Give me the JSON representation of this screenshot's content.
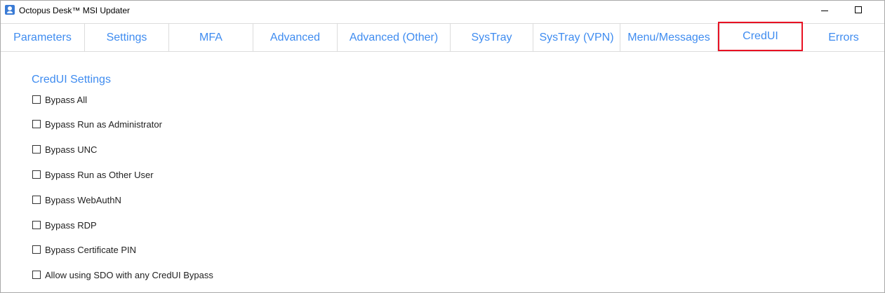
{
  "window": {
    "title": "Octopus Desk™ MSI Updater"
  },
  "tabs": [
    {
      "label": "Parameters"
    },
    {
      "label": "Settings"
    },
    {
      "label": "MFA"
    },
    {
      "label": "Advanced"
    },
    {
      "label": "Advanced (Other)"
    },
    {
      "label": "SysTray"
    },
    {
      "label": "SysTray (VPN)"
    },
    {
      "label": "Menu/Messages"
    },
    {
      "label": "CredUI"
    },
    {
      "label": "Errors"
    }
  ],
  "active_tab": "CredUI",
  "section": {
    "title": "CredUI Settings",
    "options": [
      {
        "label": "Bypass All",
        "checked": false
      },
      {
        "label": "Bypass Run as Administrator",
        "checked": false
      },
      {
        "label": "Bypass UNC",
        "checked": false
      },
      {
        "label": "Bypass Run as Other User",
        "checked": false
      },
      {
        "label": "Bypass WebAuthN",
        "checked": false
      },
      {
        "label": "Bypass RDP",
        "checked": false
      },
      {
        "label": "Bypass Certificate PIN",
        "checked": false
      },
      {
        "label": "Allow using SDO with any CredUI Bypass",
        "checked": false
      }
    ]
  },
  "colors": {
    "accent": "#3f8cf0",
    "highlight": "#e81123"
  }
}
